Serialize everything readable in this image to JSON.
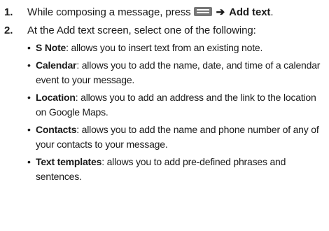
{
  "steps": [
    {
      "number": "1.",
      "text_before": "While composing a message, press",
      "menu_key_icon": "menu-key-icon",
      "arrow": "➔",
      "action": "Add text",
      "suffix": "."
    },
    {
      "number": "2.",
      "text": "At the Add text screen, select one of the following:",
      "options": [
        {
          "bullet": "•",
          "term": "S Note",
          "description": ": allows you to insert text from an existing note."
        },
        {
          "bullet": "•",
          "term": "Calendar",
          "description": ": allows you to add the name, date, and time of a calendar event to your message."
        },
        {
          "bullet": "•",
          "term": "Location",
          "description": ": allows you to add an address and the link to the location on Google Maps."
        },
        {
          "bullet": "•",
          "term": "Contacts",
          "description": ": allows you to add the name and phone number of any of your contacts to your message."
        },
        {
          "bullet": "•",
          "term": "Text templates",
          "description": ": allows you to add pre-defined phrases and sentences."
        }
      ]
    }
  ]
}
